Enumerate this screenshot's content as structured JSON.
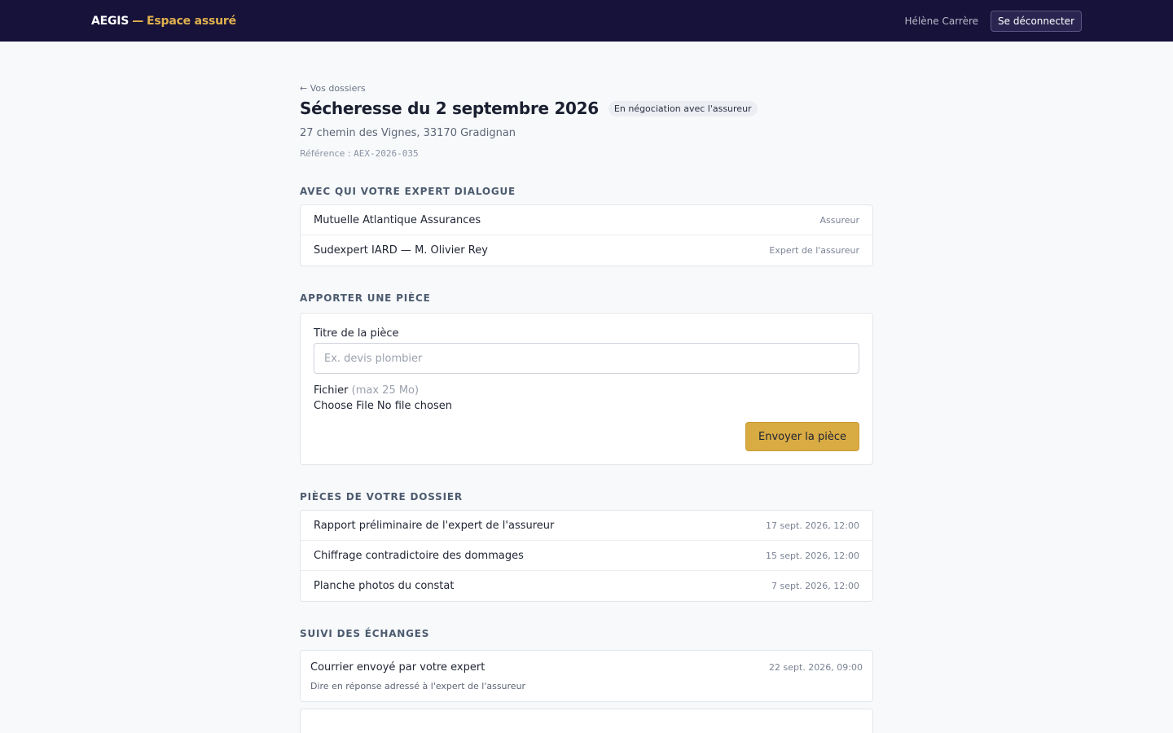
{
  "header": {
    "brand_name": "AEGIS",
    "brand_separator": "—",
    "brand_suffix": "Espace assuré",
    "user_name": "Hélène Carrère",
    "logout_label": "Se déconnecter"
  },
  "claim": {
    "back_label": "← Vos dossiers",
    "title": "Sécheresse du 2 septembre 2026",
    "status": "En négociation avec l'assureur",
    "address": "27 chemin des Vignes, 33170 Gradignan",
    "reference_label": "Référence : ",
    "reference_code": "AEX-2026-035"
  },
  "contacts": {
    "section_title": "Avec qui votre expert dialogue",
    "items": [
      {
        "name": "Mutuelle Atlantique Assurances",
        "role": "Assureur"
      },
      {
        "name": "Sudexpert IARD — M. Olivier Rey",
        "role": "Expert de l'assureur"
      }
    ]
  },
  "upload": {
    "section_title": "Apporter une pièce",
    "title_label": "Titre de la pièce",
    "title_placeholder": "Ex. devis plombier",
    "file_label": "Fichier",
    "file_hint": "(max 25 Mo)",
    "choose_file_label": "Choose File",
    "no_file_label": "No file chosen",
    "submit_label": "Envoyer la pièce"
  },
  "documents": {
    "section_title": "Pièces de votre dossier",
    "items": [
      {
        "title": "Rapport préliminaire de l'expert de l'assureur",
        "date": "17 sept. 2026, 12:00"
      },
      {
        "title": "Chiffrage contradictoire des dommages",
        "date": "15 sept. 2026, 12:00"
      },
      {
        "title": "Planche photos du constat",
        "date": "7 sept. 2026, 12:00"
      }
    ]
  },
  "exchanges": {
    "section_title": "Suivi des échanges",
    "items": [
      {
        "title": "Courrier envoyé par votre expert",
        "date": "22 sept. 2026, 09:00",
        "description": "Dire en réponse adressé à l'expert de l'assureur"
      }
    ]
  }
}
